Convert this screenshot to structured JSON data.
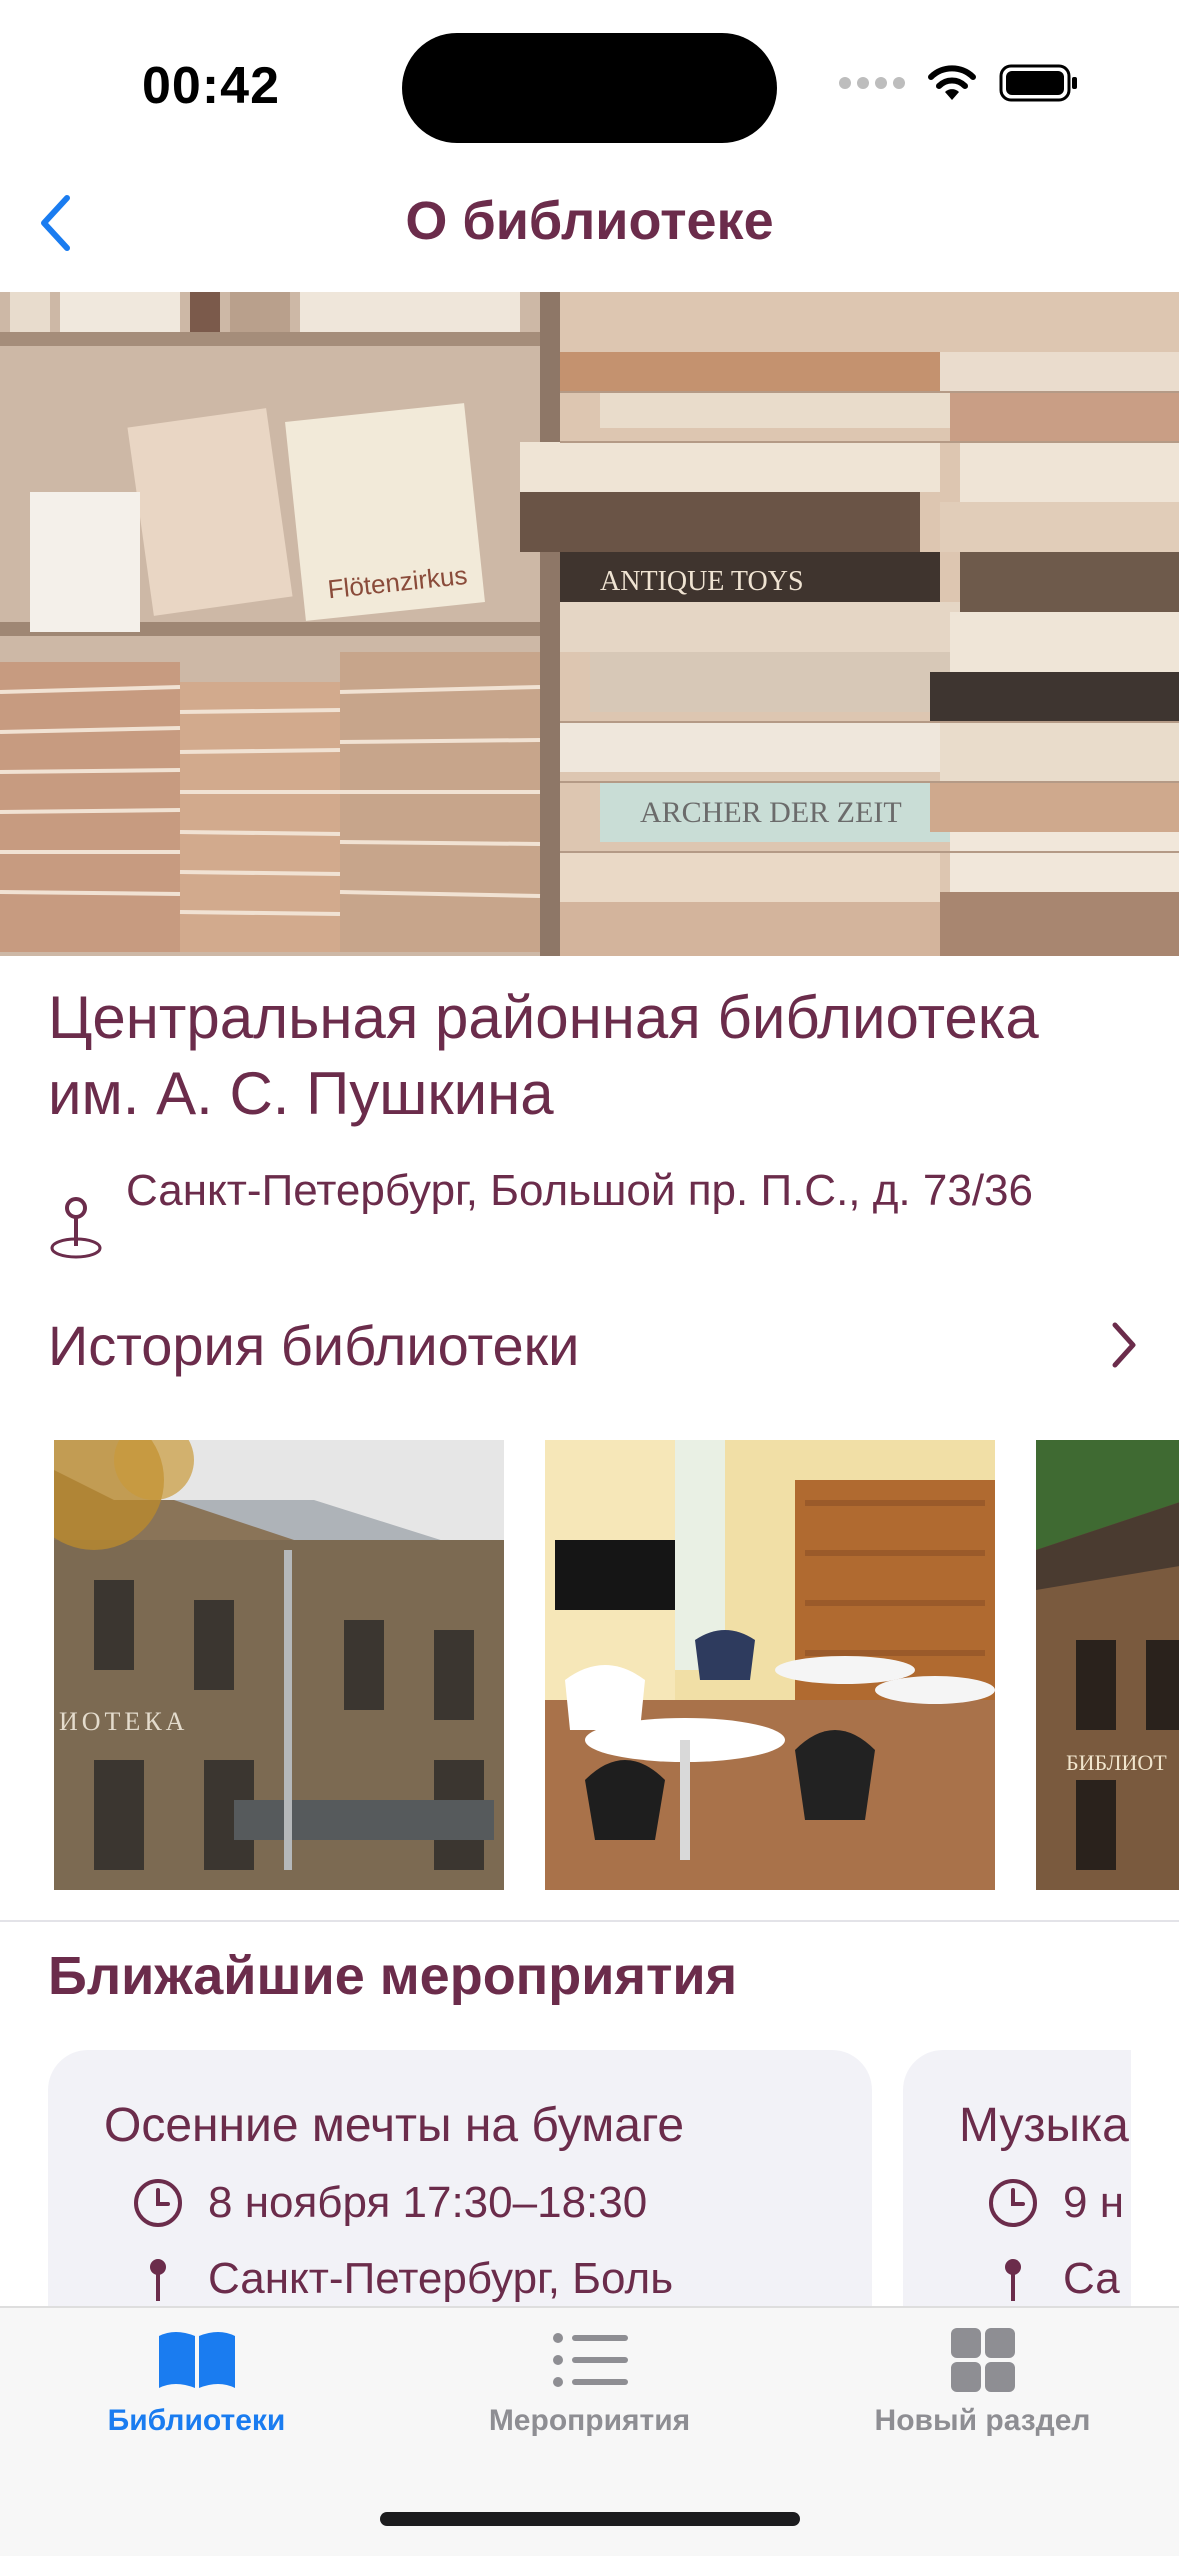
{
  "status_bar": {
    "time": "00:42"
  },
  "nav": {
    "title": "О библиотеке",
    "back_icon": "chevron-left-icon"
  },
  "library": {
    "name": "Центральная районная библиотека им. А. С. Пушкина",
    "address": "Санкт-Петербург, Большой пр. П.С., д. 73/36"
  },
  "history": {
    "label": "История библиотеки"
  },
  "events_section": {
    "title": "Ближайшие мероприятия",
    "events": [
      {
        "title": "Осенние мечты на бумаге",
        "datetime": "8 ноября 17:30–18:30",
        "location": "Санкт-Петербург, Боль"
      },
      {
        "title": "Музыка",
        "datetime": "9 н",
        "location": "Са"
      }
    ]
  },
  "tabs": [
    {
      "label": "Библиотеки",
      "icon": "book-icon",
      "active": true
    },
    {
      "label": "Мероприятия",
      "icon": "list-icon",
      "active": false
    },
    {
      "label": "Новый раздел",
      "icon": "grid-icon",
      "active": false
    }
  ],
  "colors": {
    "accent": "#6b2c4b",
    "tab_active": "#1a7cf0",
    "tab_inactive": "#8e8e93"
  }
}
